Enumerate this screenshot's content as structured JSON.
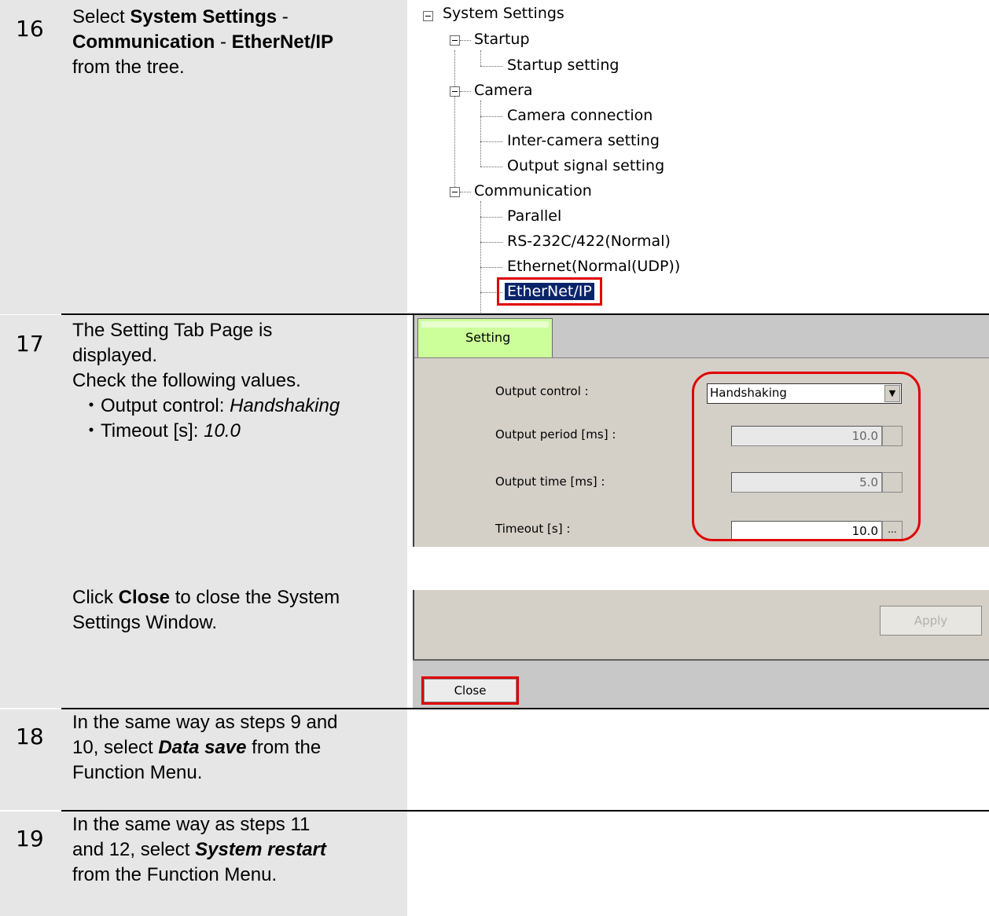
{
  "steps": [
    {
      "number": "16",
      "lines": [
        {
          "parts": [
            {
              "t": "Select ",
              "s": ""
            },
            {
              "t": "System Settings",
              "s": "b"
            },
            {
              "t": " -",
              "s": ""
            }
          ]
        },
        {
          "parts": [
            {
              "t": "Communication",
              "s": "b"
            },
            {
              "t": " - ",
              "s": ""
            },
            {
              "t": "EtherNet/IP",
              "s": "b"
            }
          ]
        },
        {
          "parts": [
            {
              "t": "from the tree.",
              "s": ""
            }
          ]
        }
      ]
    },
    {
      "number": "17",
      "lines": [
        {
          "parts": [
            {
              "t": "The Setting Tab Page is",
              "s": ""
            }
          ]
        },
        {
          "parts": [
            {
              "t": "displayed.",
              "s": ""
            }
          ]
        },
        {
          "parts": [
            {
              "t": "Check the following values.",
              "s": ""
            }
          ]
        },
        {
          "parts": [
            {
              "t": "・Output control: ",
              "s": ""
            },
            {
              "t": "Handshaking",
              "s": "i"
            }
          ],
          "bullet": true
        },
        {
          "parts": [
            {
              "t": "・Timeout [s]: ",
              "s": ""
            },
            {
              "t": "10.0",
              "s": "i"
            }
          ],
          "bullet": true
        }
      ],
      "lines_b": [
        {
          "parts": [
            {
              "t": "Click ",
              "s": ""
            },
            {
              "t": "Close",
              "s": "b"
            },
            {
              "t": " to close the System",
              "s": ""
            }
          ]
        },
        {
          "parts": [
            {
              "t": "Settings Window.",
              "s": ""
            }
          ]
        }
      ]
    },
    {
      "number": "18",
      "lines": [
        {
          "parts": [
            {
              "t": "In the same way as steps 9 and",
              "s": ""
            }
          ]
        },
        {
          "parts": [
            {
              "t": "10, select ",
              "s": ""
            },
            {
              "t": "Data save",
              "s": "bi"
            },
            {
              "t": " from the",
              "s": ""
            }
          ]
        },
        {
          "parts": [
            {
              "t": "Function Menu.",
              "s": ""
            }
          ]
        }
      ]
    },
    {
      "number": "19",
      "lines": [
        {
          "parts": [
            {
              "t": "In the same way as steps 11",
              "s": ""
            }
          ]
        },
        {
          "parts": [
            {
              "t": "and 12, select ",
              "s": ""
            },
            {
              "t": "System restart",
              "s": "bi"
            }
          ]
        },
        {
          "parts": [
            {
              "t": "from the Function Menu.",
              "s": ""
            }
          ]
        }
      ]
    }
  ],
  "tree": {
    "root": "System Settings",
    "startup": "Startup",
    "startup_setting": "Startup setting",
    "camera": "Camera",
    "camera_connection": "Camera connection",
    "inter_camera": "Inter-camera setting",
    "output_signal": "Output signal setting",
    "communication": "Communication",
    "parallel": "Parallel",
    "rs232": "RS-232C/422(Normal)",
    "ethernet": "Ethernet(Normal(UDP))",
    "ethernetip": "EtherNet/IP"
  },
  "setting_window": {
    "tab": "Setting",
    "output_control_label": "Output control :",
    "output_control_value": "Handshaking",
    "output_period_label": "Output period [ms] :",
    "output_period_value": "10.0",
    "output_time_label": "Output time [ms] :",
    "output_time_value": "5.0",
    "timeout_label": "Timeout [s] :",
    "timeout_value": "10.0",
    "spin_glyph": "..."
  },
  "bottom_window": {
    "apply_label": "Apply",
    "close_label": "Close"
  },
  "colors": {
    "cell_bg": "#e6e6e6",
    "highlight_red": "#e00000",
    "tab_green": "#ccff99",
    "window_gray": "#d4d0c8"
  }
}
